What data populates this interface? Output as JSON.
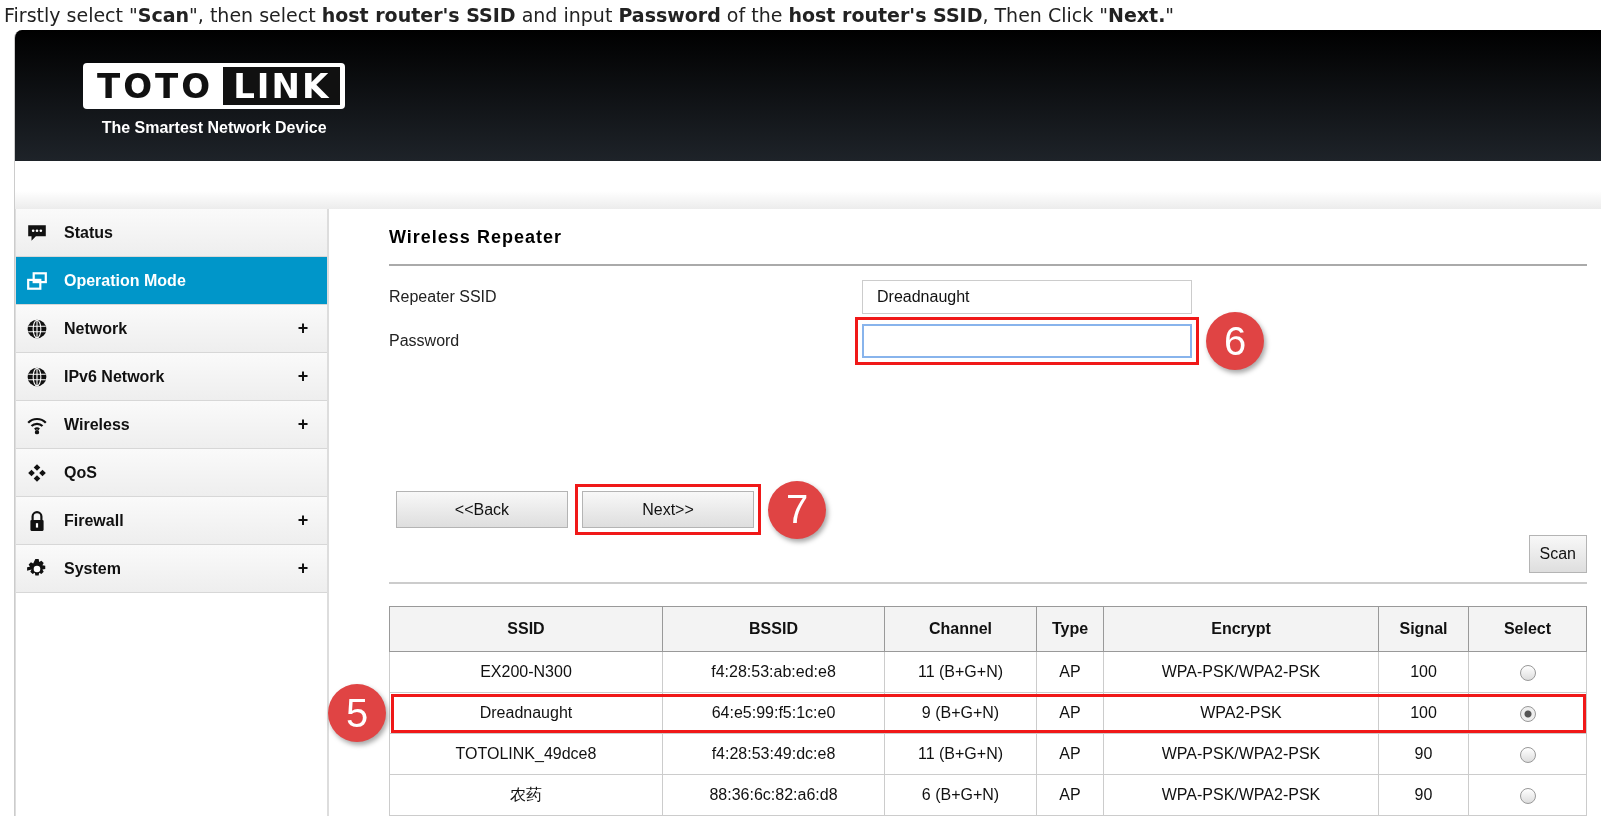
{
  "instruction": "Firstly select \"**Scan**\", then select **host router's SSID** and input **Password** of the **host router's SSID**, Then Click \"**Next.**\"",
  "header": {
    "logo_left": "TOTO",
    "logo_right": "LINK",
    "tagline": "The Smartest Network Device"
  },
  "sidebar": {
    "items": [
      {
        "kind": "status",
        "label": "Status",
        "selected": false
      },
      {
        "kind": "mode",
        "label": "Operation Mode",
        "selected": true
      },
      {
        "kind": "globe",
        "label": "Network",
        "selected": false,
        "expand_sign": "+"
      },
      {
        "kind": "globe",
        "label": "IPv6 Network",
        "selected": false,
        "expand_sign": "+"
      },
      {
        "kind": "wifi",
        "label": "Wireless",
        "selected": false,
        "expand_sign": "+"
      },
      {
        "kind": "qos",
        "label": "QoS",
        "selected": false
      },
      {
        "kind": "lock",
        "label": "Firewall",
        "selected": false,
        "expand_sign": "+"
      },
      {
        "kind": "gear",
        "label": "System",
        "selected": false,
        "expand_sign": "+"
      }
    ]
  },
  "page": {
    "title": "Wireless Repeater",
    "fields": [
      {
        "label": "Repeater SSID",
        "value": "Dreadnaught",
        "highlighted": false
      },
      {
        "label": "Password",
        "highlighted": true,
        "marker": "6"
      }
    ],
    "buttons": [
      {
        "label": "<<Back",
        "highlighted": false
      },
      {
        "label": "Next>>",
        "highlighted": true,
        "marker": "7"
      }
    ],
    "scan_button": "Scan",
    "table": {
      "columns": [
        "SSID",
        "BSSID",
        "Channel",
        "Type",
        "Encrypt",
        "Signal",
        "Select"
      ],
      "rows": [
        {
          "cells": [
            "EX200-N300",
            "f4:28:53:ab:ed:e8",
            "11 (B+G+N)",
            "AP",
            "WPA-PSK/WPA2-PSK",
            "100"
          ],
          "selected": false,
          "highlighted": false
        },
        {
          "cells": [
            "Dreadnaught",
            "64:e5:99:f5:1c:e0",
            "9 (B+G+N)",
            "AP",
            "WPA2-PSK",
            "100"
          ],
          "selected": true,
          "highlighted": true,
          "marker": "5"
        },
        {
          "cells": [
            "TOTOLINK_49dce8",
            "f4:28:53:49:dc:e8",
            "11 (B+G+N)",
            "AP",
            "WPA-PSK/WPA2-PSK",
            "90"
          ],
          "selected": false,
          "highlighted": false
        },
        {
          "cells": [
            "农药",
            "88:36:6c:82:a6:d8",
            "6 (B+G+N)",
            "AP",
            "WPA-PSK/WPA2-PSK",
            "90"
          ],
          "selected": false,
          "highlighted": false
        }
      ]
    }
  }
}
